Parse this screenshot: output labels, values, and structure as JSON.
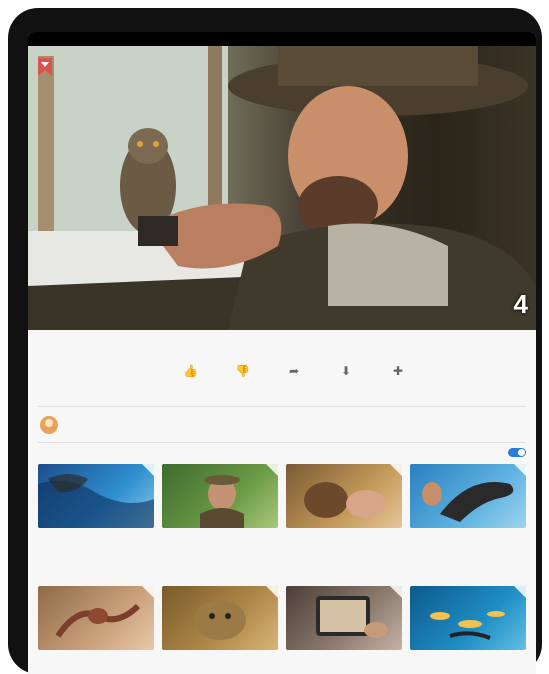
{
  "status": {
    "time": "",
    "battery": ""
  },
  "video": {
    "channel_badge": "4"
  },
  "info": {
    "title": "",
    "views": "",
    "actions": [
      {
        "icon": "like-icon",
        "label": ""
      },
      {
        "icon": "dislike-icon",
        "label": ""
      },
      {
        "icon": "share-icon",
        "label": ""
      },
      {
        "icon": "download-icon",
        "label": ""
      },
      {
        "icon": "save-icon",
        "label": ""
      }
    ],
    "channel": {
      "name": "",
      "subscribers": "",
      "subscribe_label": ""
    },
    "up_next": {
      "label": "",
      "autoplay_label": ""
    }
  },
  "cards": [
    {
      "title": "",
      "meta": ""
    },
    {
      "title": "",
      "meta": ""
    },
    {
      "title": "",
      "meta": ""
    },
    {
      "title": "",
      "meta": ""
    },
    {
      "title": "",
      "meta": ""
    },
    {
      "title": "",
      "meta": ""
    },
    {
      "title": "",
      "meta": ""
    },
    {
      "title": "",
      "meta": ""
    }
  ],
  "colors": {
    "accent": "#2b7bd8",
    "subscribe": "#dd3333"
  }
}
